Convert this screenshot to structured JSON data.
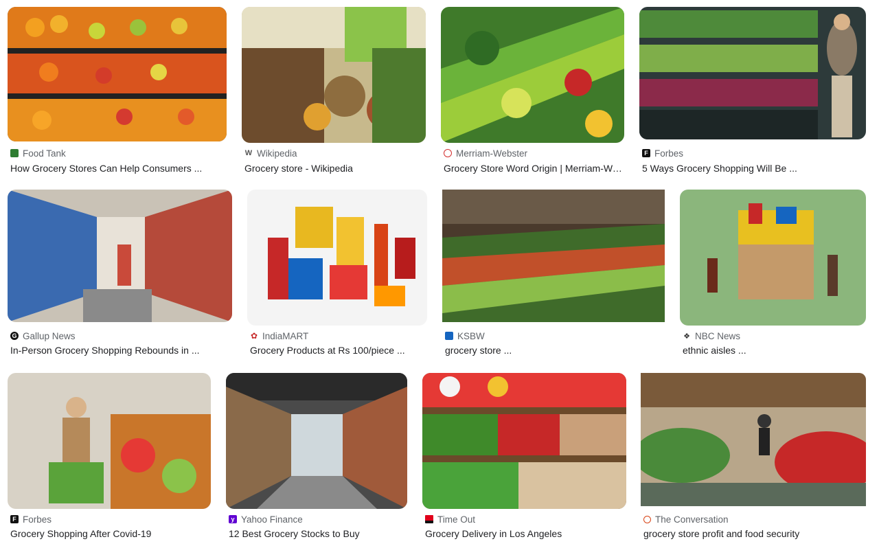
{
  "results": [
    {
      "source": "Food Tank",
      "title": "How Grocery Stores Can Help Consumers ...",
      "favicon": "food-tank-icon",
      "favicon_color": "#2e7d32"
    },
    {
      "source": "Wikipedia",
      "title": "Grocery store - Wikipedia",
      "favicon": "wikipedia-icon",
      "favicon_color": "#555555"
    },
    {
      "source": "Merriam-Webster",
      "title": "Grocery Store Word Origin | Merriam-Web...",
      "favicon": "merriam-webster-icon",
      "favicon_color": "#d32f2f"
    },
    {
      "source": "Forbes",
      "title": "5 Ways Grocery Shopping Will Be ...",
      "favicon": "forbes-icon",
      "favicon_color": "#111111"
    },
    {
      "source": "Gallup News",
      "title": "In-Person Grocery Shopping Rebounds in ...",
      "favicon": "gallup-icon",
      "favicon_color": "#111111"
    },
    {
      "source": "IndiaMART",
      "title": "Grocery Products at Rs 100/piece ...",
      "favicon": "indiamart-icon",
      "favicon_color": "#c62828"
    },
    {
      "source": "KSBW",
      "title": "grocery store ...",
      "favicon": "ksbw-icon",
      "favicon_color": "#1565c0"
    },
    {
      "source": "NBC News",
      "title": "ethnic aisles ...",
      "favicon": "nbc-icon",
      "favicon_color": "#333333"
    },
    {
      "source": "Forbes",
      "title": "Grocery Shopping After Covid-19",
      "favicon": "forbes-icon",
      "favicon_color": "#111111"
    },
    {
      "source": "Yahoo Finance",
      "title": "12 Best Grocery Stocks to Buy",
      "favicon": "yahoo-icon",
      "favicon_color": "#6001d2"
    },
    {
      "source": "Time Out",
      "title": "Grocery Delivery in Los Angeles",
      "favicon": "time-out-icon",
      "favicon_color": "#e0001b"
    },
    {
      "source": "The Conversation",
      "title": "grocery store profit and food security",
      "favicon": "the-conversation-icon",
      "favicon_color": "#d84315"
    }
  ]
}
